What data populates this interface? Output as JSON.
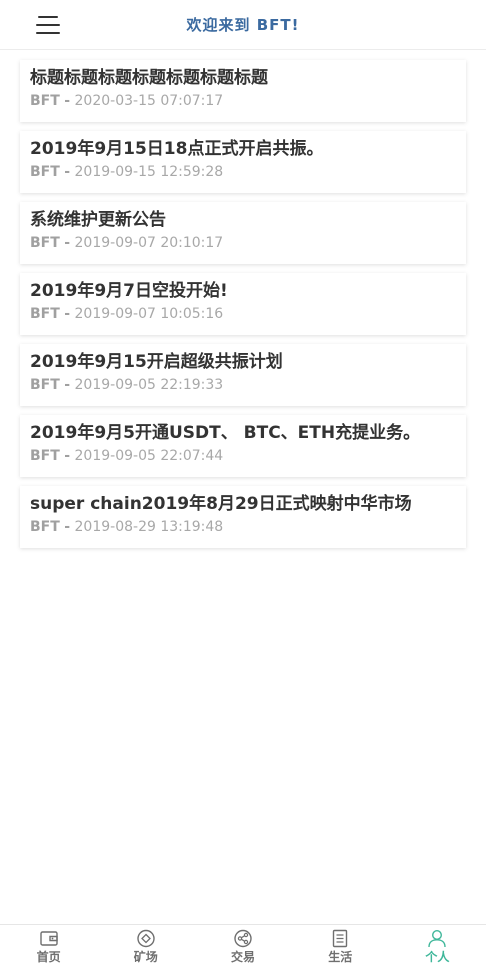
{
  "header": {
    "title": "欢迎来到 BFT!"
  },
  "news": [
    {
      "title": "标题标题标题标题标题标题标题",
      "source": "BFT",
      "separator": "-",
      "time": "2020-03-15 07:07:17"
    },
    {
      "title": "2019年9月15日18点正式开启共振。",
      "source": "BFT",
      "separator": "-",
      "time": "2019-09-15 12:59:28"
    },
    {
      "title": "系统维护更新公告",
      "source": "BFT",
      "separator": "-",
      "time": "2019-09-07 20:10:17"
    },
    {
      "title": "2019年9月7日空投开始!",
      "source": "BFT",
      "separator": "-",
      "time": "2019-09-07 10:05:16"
    },
    {
      "title": "2019年9月15开启超级共振计划",
      "source": "BFT",
      "separator": "-",
      "time": "2019-09-05 22:19:33"
    },
    {
      "title": "2019年9月5开通USDT、 BTC、ETH充提业务。",
      "source": "BFT",
      "separator": "-",
      "time": "2019-09-05 22:07:44"
    },
    {
      "title": "super chain2019年8月29日正式映射中华市场",
      "source": "BFT",
      "separator": "-",
      "time": "2019-08-29 13:19:48"
    }
  ],
  "tabbar": {
    "items": [
      {
        "label": "首页",
        "icon": "wallet-icon"
      },
      {
        "label": "矿场",
        "icon": "mine-icon"
      },
      {
        "label": "交易",
        "icon": "share-icon"
      },
      {
        "label": "生活",
        "icon": "document-icon"
      },
      {
        "label": "个人",
        "icon": "person-icon"
      }
    ],
    "active_index": 4,
    "active_color": "#3fb79a",
    "inactive_color": "#6f6f6f"
  }
}
